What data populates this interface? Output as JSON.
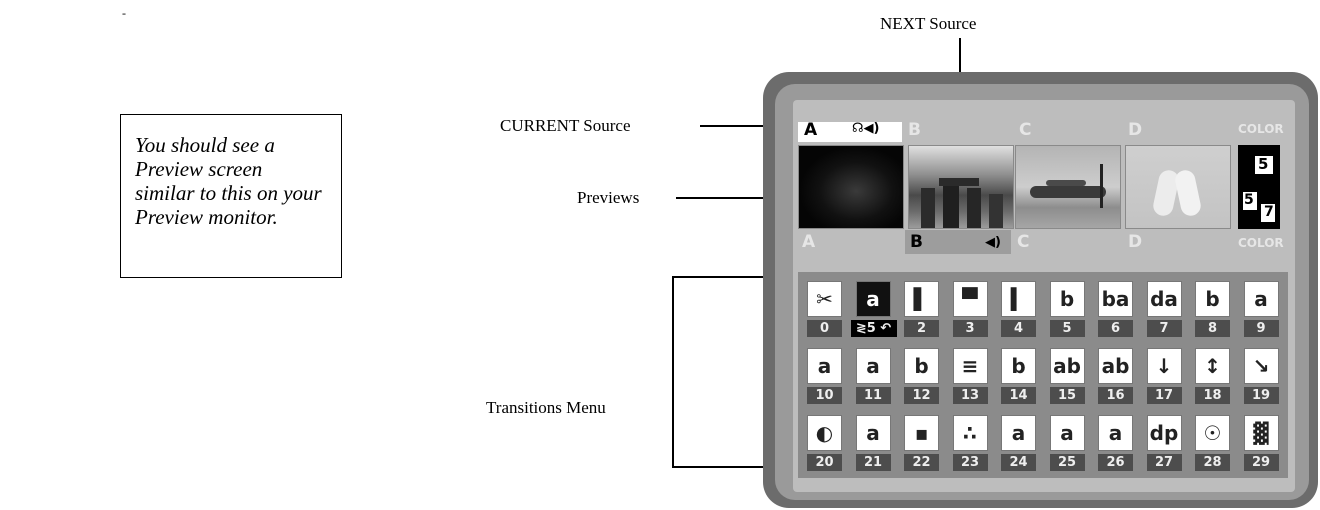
{
  "note": {
    "text": "You should see a Preview screen similar to this on your Preview monitor."
  },
  "stray_mark": "-",
  "callouts": {
    "next_source": "NEXT Source",
    "current_source": "CURRENT Source",
    "previews": "Previews",
    "transitions_menu": "Transitions Menu"
  },
  "sources_top": {
    "a": "A",
    "b": "B",
    "c": "C",
    "d": "D",
    "color": "COLOR",
    "a_icons": "☊◀)"
  },
  "sources_bottom": {
    "a": "A",
    "b": "B",
    "c": "C",
    "d": "D",
    "color": "COLOR",
    "b_icon": "◀)"
  },
  "color_preview": {
    "v1": "5",
    "v2": "5",
    "v3": "7"
  },
  "selected_info": "≷5 ↶",
  "transitions": [
    {
      "num": "0",
      "glyph": "✂"
    },
    {
      "num": "1",
      "glyph": "a"
    },
    {
      "num": "2",
      "glyph": "▌"
    },
    {
      "num": "3",
      "glyph": "▀"
    },
    {
      "num": "4",
      "glyph": "▍"
    },
    {
      "num": "5",
      "glyph": "b"
    },
    {
      "num": "6",
      "glyph": "ba"
    },
    {
      "num": "7",
      "glyph": "da"
    },
    {
      "num": "8",
      "glyph": "b"
    },
    {
      "num": "9",
      "glyph": "a"
    },
    {
      "num": "10",
      "glyph": "a"
    },
    {
      "num": "11",
      "glyph": "a"
    },
    {
      "num": "12",
      "glyph": "b"
    },
    {
      "num": "13",
      "glyph": "≡"
    },
    {
      "num": "14",
      "glyph": "b"
    },
    {
      "num": "15",
      "glyph": "ab"
    },
    {
      "num": "16",
      "glyph": "ab"
    },
    {
      "num": "17",
      "glyph": "↓"
    },
    {
      "num": "18",
      "glyph": "↕"
    },
    {
      "num": "19",
      "glyph": "↘"
    },
    {
      "num": "20",
      "glyph": "◐"
    },
    {
      "num": "21",
      "glyph": "a"
    },
    {
      "num": "22",
      "glyph": "▪"
    },
    {
      "num": "23",
      "glyph": "∴"
    },
    {
      "num": "24",
      "glyph": "a"
    },
    {
      "num": "25",
      "glyph": "a"
    },
    {
      "num": "26",
      "glyph": "a"
    },
    {
      "num": "27",
      "glyph": "dp"
    },
    {
      "num": "28",
      "glyph": "☉"
    },
    {
      "num": "29",
      "glyph": "▓"
    }
  ]
}
